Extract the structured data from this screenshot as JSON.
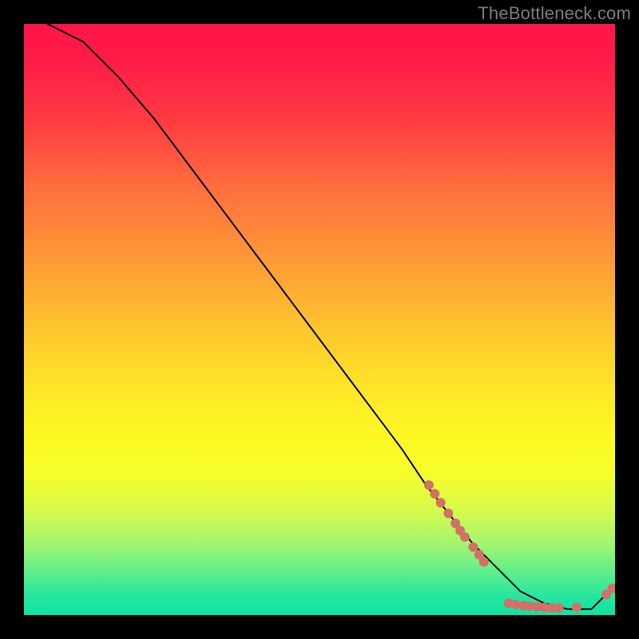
{
  "watermark": "TheBottleneck.com",
  "chart_data": {
    "type": "line",
    "title": "",
    "xlabel": "",
    "ylabel": "",
    "xlim": [
      0,
      100
    ],
    "ylim": [
      0,
      100
    ],
    "grid": false,
    "legend": false,
    "series": [
      {
        "name": "curve",
        "style": "solid-black",
        "x": [
          4,
          10,
          16,
          22,
          28,
          34,
          40,
          46,
          52,
          58,
          64,
          68,
          72,
          76,
          80,
          82,
          84,
          86,
          88,
          90,
          92,
          94,
          96,
          98,
          100
        ],
        "y": [
          100,
          97,
          91,
          84,
          76,
          68,
          60,
          52,
          44,
          36,
          28,
          22,
          17,
          12,
          8,
          6,
          4,
          3,
          2,
          1.5,
          1,
          1,
          1,
          3,
          5
        ]
      }
    ],
    "scatter_segments": [
      {
        "name": "upper-dotted-cluster",
        "color": "#d47066",
        "points": [
          {
            "x": 68.5,
            "y": 22.0
          },
          {
            "x": 69.5,
            "y": 20.5
          },
          {
            "x": 70.5,
            "y": 19.0
          },
          {
            "x": 71.8,
            "y": 17.2
          },
          {
            "x": 73.0,
            "y": 15.5
          },
          {
            "x": 73.8,
            "y": 14.3
          },
          {
            "x": 74.6,
            "y": 13.2
          },
          {
            "x": 76.0,
            "y": 11.5
          },
          {
            "x": 77.0,
            "y": 10.2
          },
          {
            "x": 77.8,
            "y": 9.0
          }
        ]
      },
      {
        "name": "bottom-dotted-cluster",
        "color": "#d47066",
        "points": [
          {
            "x": 82.0,
            "y": 2.0
          },
          {
            "x": 83.2,
            "y": 1.8
          },
          {
            "x": 84.5,
            "y": 1.6
          },
          {
            "x": 85.5,
            "y": 1.5
          },
          {
            "x": 86.8,
            "y": 1.4
          },
          {
            "x": 88.0,
            "y": 1.3
          },
          {
            "x": 89.2,
            "y": 1.2
          },
          {
            "x": 90.5,
            "y": 1.2
          },
          {
            "x": 93.5,
            "y": 1.3
          },
          {
            "x": 98.5,
            "y": 3.5
          },
          {
            "x": 99.5,
            "y": 4.5
          }
        ]
      }
    ],
    "background_gradient": {
      "top": "#ff1648",
      "upper_mid": "#ffc62e",
      "lower_mid": "#fdf923",
      "bottom": "#0fe3a4"
    }
  }
}
